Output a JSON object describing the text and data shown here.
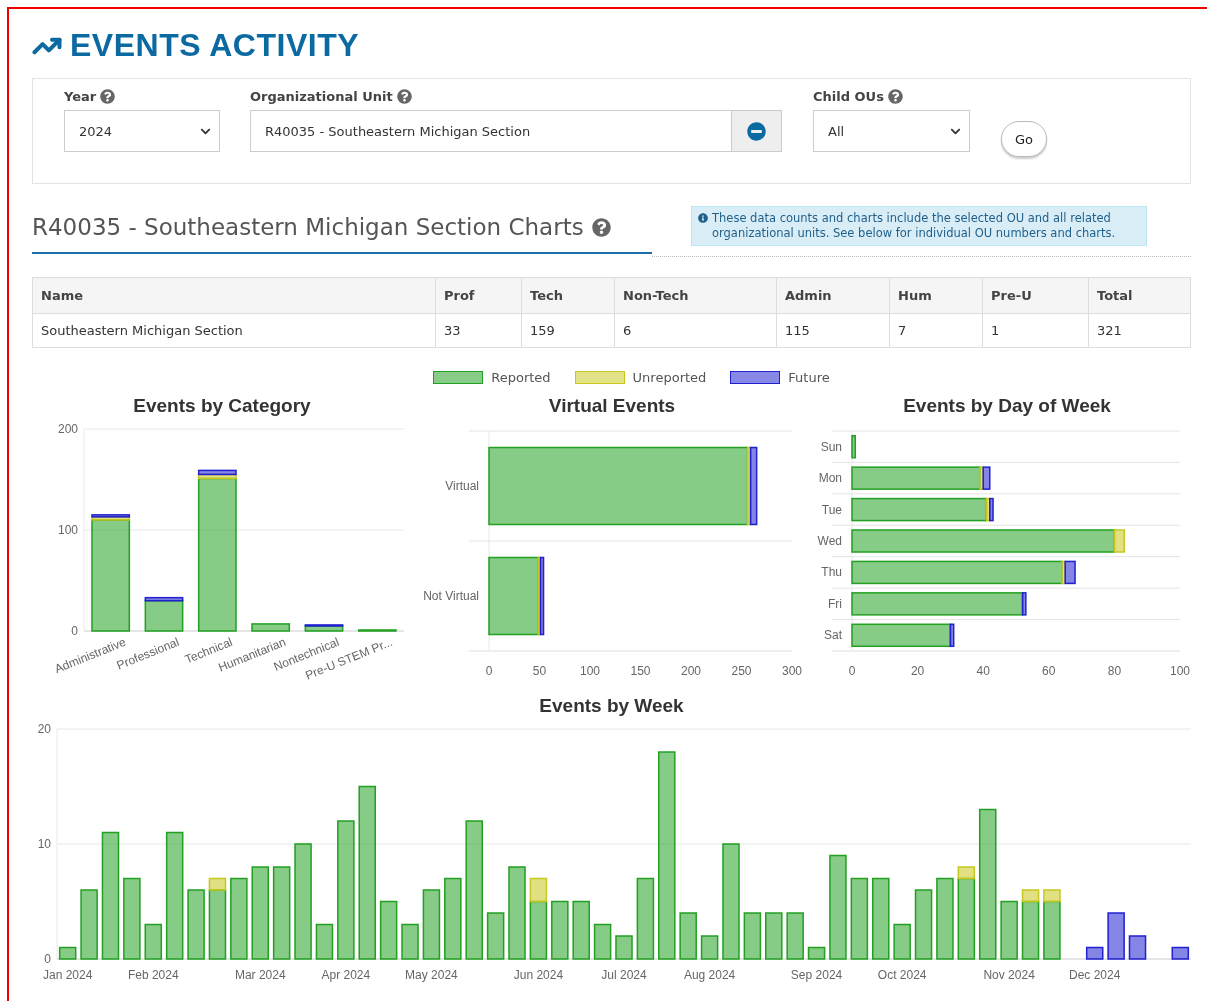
{
  "page_title": "EVENTS ACTIVITY",
  "filters": {
    "year": {
      "label": "Year",
      "value": "2024"
    },
    "org_unit": {
      "label": "Organizational Unit",
      "value": "R40035 - Southeastern Michigan Section"
    },
    "child_ous": {
      "label": "Child OUs",
      "value": "All"
    },
    "go_button": "Go"
  },
  "section_heading": "R40035 - Southeastern Michigan Section Charts",
  "info_note": "These data counts and charts include the selected OU and all related organizational units. See below for individual OU numbers and charts.",
  "table": {
    "columns": [
      "Name",
      "Prof",
      "Tech",
      "Non-Tech",
      "Admin",
      "Hum",
      "Pre-U",
      "Total"
    ],
    "rows": [
      [
        "Southeastern Michigan Section",
        "33",
        "159",
        "6",
        "115",
        "7",
        "1",
        "321"
      ]
    ]
  },
  "charts": [
    {
      "chart_data": {
        "type": "bar",
        "title": "Events by Category",
        "orientation": "vertical",
        "stacked": true,
        "categories": [
          "Administrative",
          "Professional",
          "Technical",
          "Humanitarian",
          "Nontechnical",
          "Pre-U STEM Pr..."
        ],
        "ylim": [
          0,
          200
        ],
        "yticks": [
          0,
          100,
          200
        ],
        "series": [
          {
            "name": "Reported",
            "color": "#22a022",
            "values": [
              110,
              30,
              151,
              7,
              5,
              1
            ]
          },
          {
            "name": "Unreported",
            "color": "#c8c81e",
            "values": [
              3,
              0,
              4,
              0,
              0,
              0
            ]
          },
          {
            "name": "Future",
            "color": "#2020d0",
            "values": [
              2,
              3,
              4,
              0,
              1,
              0
            ]
          }
        ]
      }
    },
    {
      "chart_data": {
        "type": "bar",
        "title": "Virtual Events",
        "orientation": "horizontal",
        "stacked": true,
        "categories": [
          "Virtual",
          "Not Virtual"
        ],
        "xlim": [
          0,
          300
        ],
        "xticks": [
          0,
          50,
          100,
          150,
          200,
          250,
          300
        ],
        "series": [
          {
            "color": "#22a022",
            "values": [
              256,
              49
            ]
          },
          {
            "color": "#c8c81e",
            "values": [
              3,
              2
            ]
          },
          {
            "color": "#2020d0",
            "values": [
              6,
              3
            ]
          }
        ]
      }
    },
    {
      "chart_data": {
        "type": "bar",
        "title": "Events by Day of Week",
        "orientation": "horizontal",
        "stacked": true,
        "categories": [
          "Sun",
          "Mon",
          "Tue",
          "Wed",
          "Thu",
          "Fri",
          "Sat"
        ],
        "xlim": [
          0,
          100
        ],
        "xticks": [
          0,
          20,
          40,
          60,
          80,
          100
        ],
        "series": [
          {
            "color": "#22a022",
            "values": [
              1,
              39,
              41,
              80,
              64,
              52,
              30
            ]
          },
          {
            "color": "#c8c81e",
            "values": [
              0,
              1,
              1,
              3,
              1,
              0,
              0
            ]
          },
          {
            "color": "#2020d0",
            "values": [
              0,
              2,
              1,
              0,
              3,
              1,
              1
            ]
          }
        ]
      }
    },
    {
      "chart_data": {
        "type": "bar",
        "title": "Events by Week",
        "orientation": "vertical",
        "stacked": true,
        "categories": [
          "Jan 2024",
          null,
          null,
          null,
          "Feb 2024",
          null,
          null,
          null,
          null,
          "Mar 2024",
          null,
          null,
          null,
          "Apr 2024",
          null,
          null,
          null,
          "May 2024",
          null,
          null,
          null,
          null,
          "Jun 2024",
          null,
          null,
          null,
          "Jul 2024",
          null,
          null,
          null,
          "Aug 2024",
          null,
          null,
          null,
          null,
          "Sep 2024",
          null,
          null,
          null,
          "Oct 2024",
          null,
          null,
          null,
          null,
          "Nov 2024",
          null,
          null,
          null,
          "Dec 2024",
          null,
          null,
          null,
          null
        ],
        "ylim": [
          0,
          20
        ],
        "yticks": [
          0,
          10,
          20
        ],
        "series": [
          {
            "color": "#22a022",
            "values": [
              1,
              6,
              11,
              7,
              3,
              11,
              6,
              6,
              7,
              8,
              8,
              10,
              3,
              12,
              15,
              5,
              3,
              6,
              7,
              12,
              4,
              8,
              5,
              5,
              5,
              3,
              2,
              7,
              18,
              4,
              2,
              10,
              4,
              4,
              4,
              1,
              9,
              7,
              7,
              3,
              6,
              7,
              7,
              13,
              5,
              5,
              5,
              0,
              0,
              0,
              0,
              0,
              0
            ]
          },
          {
            "color": "#c8c81e",
            "values": [
              0,
              0,
              0,
              0,
              0,
              0,
              0,
              1,
              0,
              0,
              0,
              0,
              0,
              0,
              0,
              0,
              0,
              0,
              0,
              0,
              0,
              0,
              2,
              0,
              0,
              0,
              0,
              0,
              0,
              0,
              0,
              0,
              0,
              0,
              0,
              0,
              0,
              0,
              0,
              0,
              0,
              0,
              1,
              0,
              0,
              1,
              1,
              0,
              0,
              0,
              0,
              0,
              0
            ]
          },
          {
            "color": "#2020d0",
            "values": [
              0,
              0,
              0,
              0,
              0,
              0,
              0,
              0,
              0,
              0,
              0,
              0,
              0,
              0,
              0,
              0,
              0,
              0,
              0,
              0,
              0,
              0,
              0,
              0,
              0,
              0,
              0,
              0,
              0,
              0,
              0,
              0,
              0,
              0,
              0,
              0,
              0,
              0,
              0,
              0,
              0,
              0,
              0,
              0,
              0,
              0,
              0,
              0,
              1,
              4,
              2,
              0,
              1
            ]
          }
        ]
      }
    }
  ]
}
